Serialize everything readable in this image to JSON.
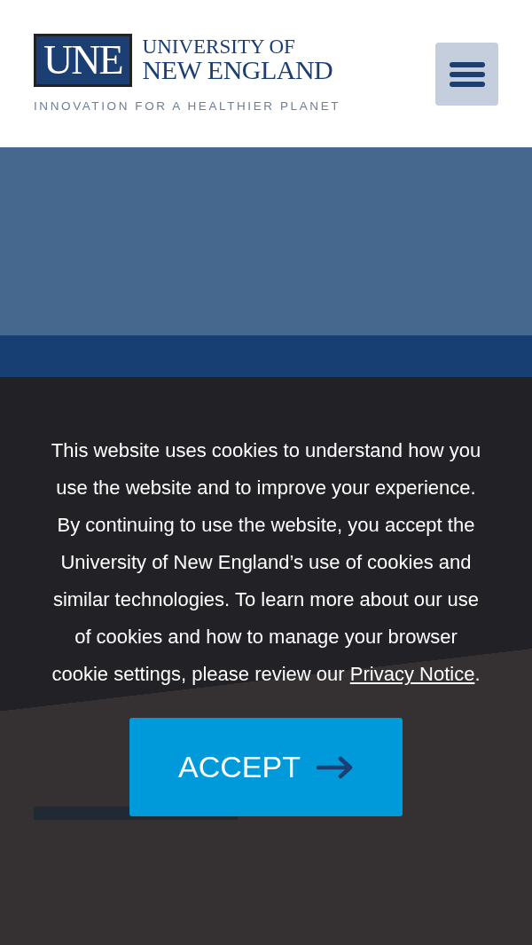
{
  "header": {
    "logo": {
      "mark": "UNE",
      "line1": "UNIVERSITY OF",
      "line2": "NEW ENGLAND",
      "tagline": "INNOVATION FOR A HEALTHIER PLANET"
    }
  },
  "cookie_banner": {
    "message_before": "This website uses cookies to understand how you use the website and to improve your experience. By continuing to use the website, you accept the University of New England’s use of cookies and similar technologies. To learn more about our use of cookies and how to manage your browser cookie settings, please review our",
    "link": "Privacy Notice",
    "message_after": ".",
    "button": "ACCEPT"
  }
}
